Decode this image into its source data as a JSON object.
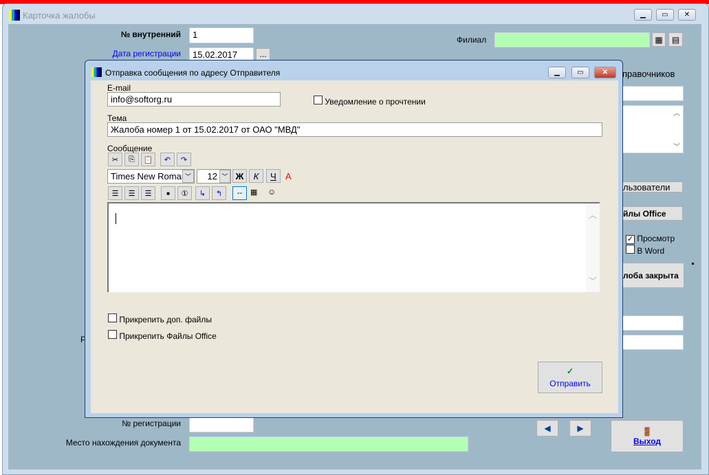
{
  "main_window": {
    "title": "Карточка жалобы",
    "internal_no_label": "№ внутренний",
    "internal_no_value": "1",
    "reg_date_label": "Дата регистрации",
    "reg_date_value": "15.02.2017",
    "date_picker_label": "...",
    "branch_label": "Филиал",
    "branch_value": "",
    "dictionaries_label": "правочников",
    "users_button": "льзователи",
    "office_files_button": "йлы Office",
    "preview_label": "Просмотр",
    "preview_checked": true,
    "word_label": "В Word",
    "word_checked": false,
    "closed_button": "лоба закрыта",
    "partial_label": "Р",
    "reg_no_label": "№ регистрации",
    "reg_no_value": "",
    "location_label": "Место нахождения документа",
    "location_value": "",
    "exit_label": "Выход"
  },
  "dialog": {
    "title": "Отправка сообщения по адресу Отправителя",
    "email_label": "E-mail",
    "email_value": "info@softorg.ru",
    "read_receipt_label": "Уведомление о прочтении",
    "subject_label": "Тема",
    "subject_value": "Жалоба номер 1 от 15.02.2017 от ОАО \"МВД\"",
    "message_label": "Сообщение",
    "font_name": "Times New Roman",
    "font_size": "12",
    "bold": "Ж",
    "italic": "К",
    "underline": "Ч",
    "color": "A",
    "hr_label": "--",
    "attach_files_label": "Прикрепить доп. файлы",
    "attach_office_label": "Прикрепить Файлы Office",
    "send_label": "Отправить"
  },
  "colors": {
    "form_bg": "#9fb8c8",
    "dialog_bg": "#ebe7da",
    "field_green": "#b3ffb3",
    "link": "#0000ff"
  }
}
